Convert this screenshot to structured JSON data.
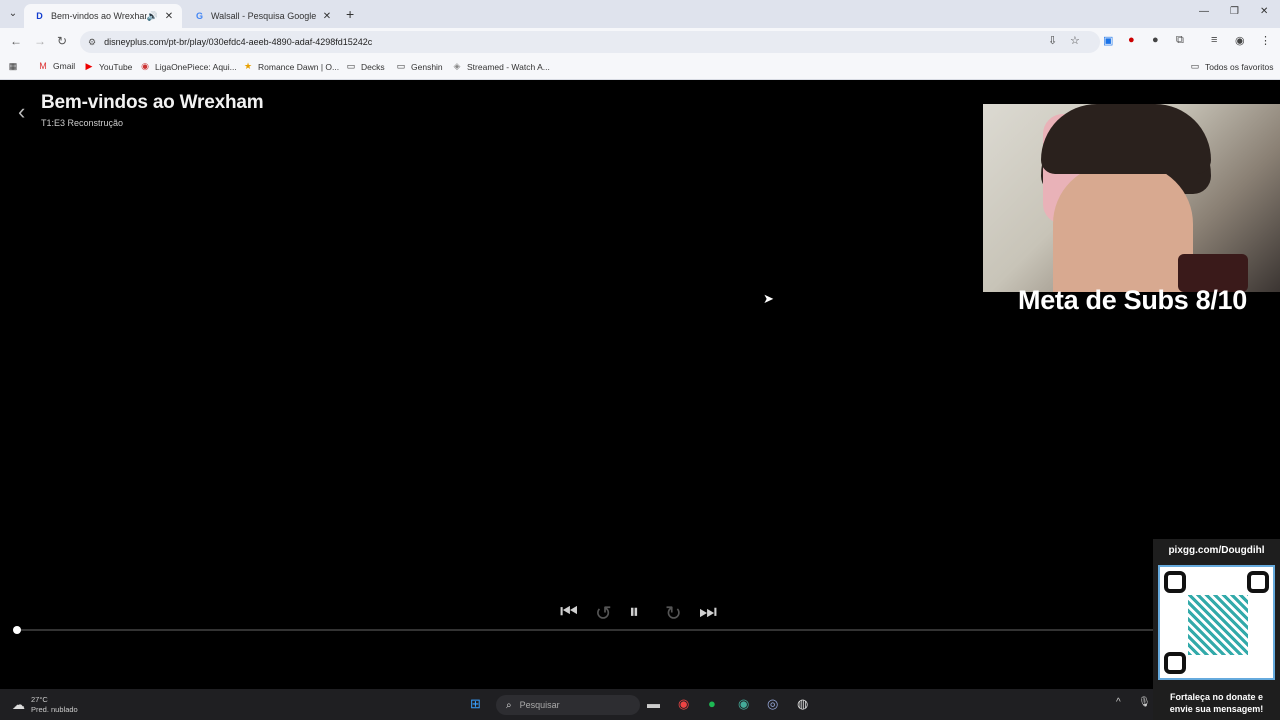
{
  "browser": {
    "tabs": [
      {
        "label": "Bem-vindos ao Wrexham |",
        "favicon": "disney-icon",
        "active": true,
        "audio": true
      },
      {
        "label": "Walsall - Pesquisa Google",
        "favicon": "google-icon",
        "active": false,
        "audio": false
      }
    ],
    "url": "disneyplus.com/pt-br/play/030efdc4-aeeb-4890-adaf-4298fd15242c",
    "bookmarks": [
      {
        "label": "Gmail",
        "icon": "gmail-icon"
      },
      {
        "label": "YouTube",
        "icon": "youtube-icon"
      },
      {
        "label": "LigaOnePiece: Aqui...",
        "icon": "onepiece-icon"
      },
      {
        "label": "Romance Dawn | O...",
        "icon": "star-icon"
      },
      {
        "label": "Decks",
        "icon": "folder-icon"
      },
      {
        "label": "Genshin",
        "icon": "folder-icon"
      },
      {
        "label": "Streamed - Watch A...",
        "icon": "stream-icon"
      }
    ],
    "all_bookmarks": "Todos os favoritos"
  },
  "player": {
    "title": "Bem-vindos ao Wrexham",
    "episode": "T1:E3 Reconstrução",
    "progress": 0.0
  },
  "overlay": {
    "goal_text": "Meta de Subs 8/10",
    "pix_url": "pixgg.com/Dougdihl",
    "donate_text_1": "Fortaleça no donate e",
    "donate_text_2": "envie sua mensagem!"
  },
  "taskbar": {
    "temp": "27°C",
    "weather": "Pred. nublado",
    "search_placeholder": "Pesquisar"
  }
}
